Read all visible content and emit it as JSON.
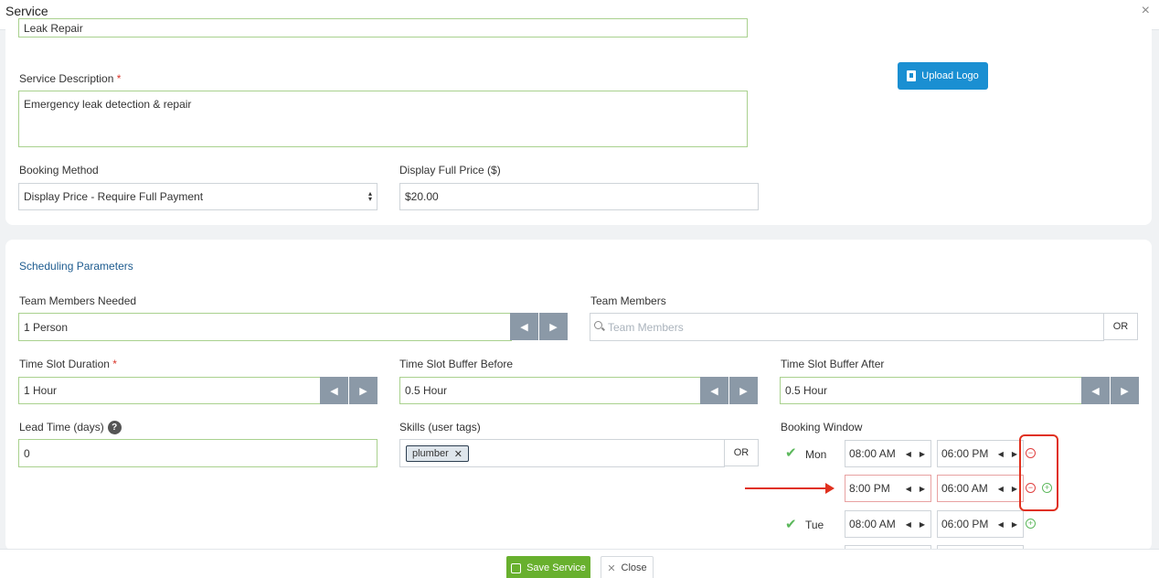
{
  "header": {
    "title": "Service",
    "close_glyph": "×"
  },
  "service": {
    "name_value": "Leak Repair",
    "description_label": "Service Description",
    "description_value": "Emergency leak detection & repair",
    "booking_method_label": "Booking Method",
    "booking_method_value": "Display Price - Require Full Payment",
    "price_label": "Display Full Price ($)",
    "price_value": "$20.00",
    "upload_logo_label": "Upload Logo",
    "required_mark": "*"
  },
  "scheduling": {
    "title": "Scheduling Parameters",
    "team_needed_label": "Team Members Needed",
    "team_needed_value": "1 Person",
    "team_members_label": "Team Members",
    "team_members_placeholder": "Team Members",
    "or_label": "OR",
    "slot_duration_label": "Time Slot Duration",
    "slot_duration_value": "1 Hour",
    "buffer_before_label": "Time Slot Buffer Before",
    "buffer_before_value": "0.5 Hour",
    "buffer_after_label": "Time Slot Buffer After",
    "buffer_after_value": "0.5 Hour",
    "lead_time_label": "Lead Time (days)",
    "lead_time_value": "0",
    "skills_label": "Skills (user tags)",
    "skill_tags": [
      "plumber"
    ],
    "booking_window_label": "Booking Window",
    "booking_window": [
      {
        "day": "Mon",
        "start": "08:00 AM",
        "end": "06:00 PM"
      },
      {
        "day": "",
        "start": "8:00 PM",
        "end": "06:00 AM"
      },
      {
        "day": "Tue",
        "start": "08:00 AM",
        "end": "06:00 PM"
      }
    ]
  },
  "footer": {
    "save_label": "Save Service",
    "close_label": "Close"
  },
  "colors": {
    "accent": "#1a8fd2",
    "save": "#68b02e",
    "annotation": "#e0301e",
    "valid_border": "#a9d18e"
  }
}
